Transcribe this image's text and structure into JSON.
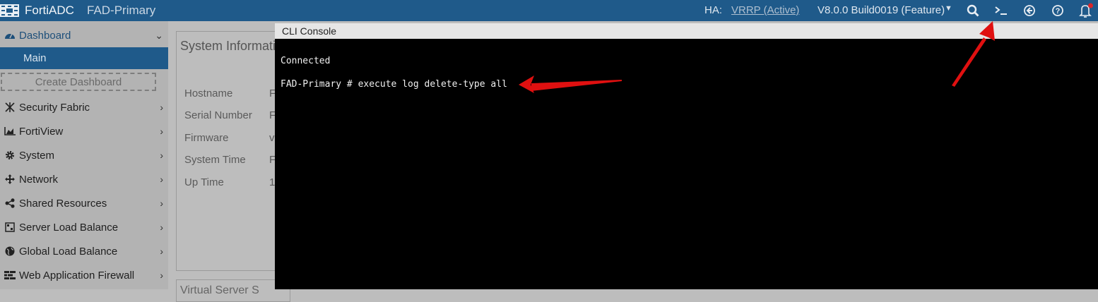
{
  "topbar": {
    "brand": "FortiADC",
    "device": "FAD-Primary",
    "ha_label": "HA:",
    "ha_value": "VRRP (Active)",
    "version": "V8.0.0 Build0019 (Feature)"
  },
  "sidebar": {
    "dashboard": "Dashboard",
    "main": "Main",
    "create_dashboard": "Create Dashboard",
    "items": [
      {
        "label": "Security Fabric",
        "icon": "security-fabric-icon"
      },
      {
        "label": "FortiView",
        "icon": "fortiview-icon"
      },
      {
        "label": "System",
        "icon": "gear-icon"
      },
      {
        "label": "Network",
        "icon": "network-icon"
      },
      {
        "label": "Shared Resources",
        "icon": "share-icon"
      },
      {
        "label": "Server Load Balance",
        "icon": "server-lb-icon"
      },
      {
        "label": "Global Load Balance",
        "icon": "globe-icon"
      },
      {
        "label": "Web Application Firewall",
        "icon": "waf-icon"
      }
    ]
  },
  "system_info": {
    "title": "System Informati",
    "rows": [
      {
        "label": "Hostname",
        "value": "F"
      },
      {
        "label": "Serial Number",
        "value": "F"
      },
      {
        "label": "Firmware",
        "value": "v"
      },
      {
        "label": "System Time",
        "value": "F"
      },
      {
        "label": "Up Time",
        "value": "1"
      }
    ],
    "next_widget": "Virtual Server S"
  },
  "cli": {
    "title": "CLI Console",
    "lines": [
      "Connected",
      "FAD-Primary # execute log delete-type all"
    ]
  },
  "colors": {
    "topbar": "#1f5a8a",
    "annotation_arrow": "#e01010",
    "notification_dot": "#d9262a"
  }
}
